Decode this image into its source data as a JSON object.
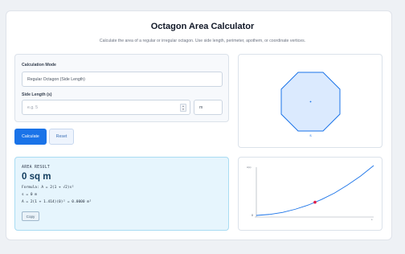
{
  "header": {
    "title": "Octagon Area Calculator",
    "subtitle": "Calculate the area of a regular or irregular octagon. Use side length, perimeter, apothem, or coordinate vertices."
  },
  "form": {
    "mode_label": "Calculation Mode",
    "mode_value": "Regular Octagon (Side Length)",
    "side_label": "Side Length (s)",
    "side_placeholder": "e.g. 5",
    "unit_value": "m"
  },
  "buttons": {
    "calculate": "Calculate",
    "reset": "Reset",
    "copy": "Copy"
  },
  "result": {
    "heading": "AREA RESULT",
    "value": "0 sq m",
    "formula": "Formula: A = 2(1 + √2)s²",
    "side": "s = 0 m",
    "computation": "A = 2(1 + 1.414)(0)² = 0.0000 m²"
  },
  "shape": {
    "side_marker": "s",
    "fill": "#dbeafe",
    "stroke": "#1a73e8"
  },
  "chart_data": {
    "type": "line",
    "title": "",
    "xlabel": "s",
    "ylabel": "A(s)",
    "y_tick_labels": [
      "0"
    ],
    "series": [
      {
        "values": [
          0,
          0.4,
          1.2,
          2.5,
          4.2,
          6.4,
          9.0,
          12.2,
          15.8,
          20.0
        ]
      }
    ],
    "current_point": {
      "x": 4.5,
      "y": 5.3
    },
    "color": "#1a73e8",
    "point_color": "#e11d48"
  }
}
